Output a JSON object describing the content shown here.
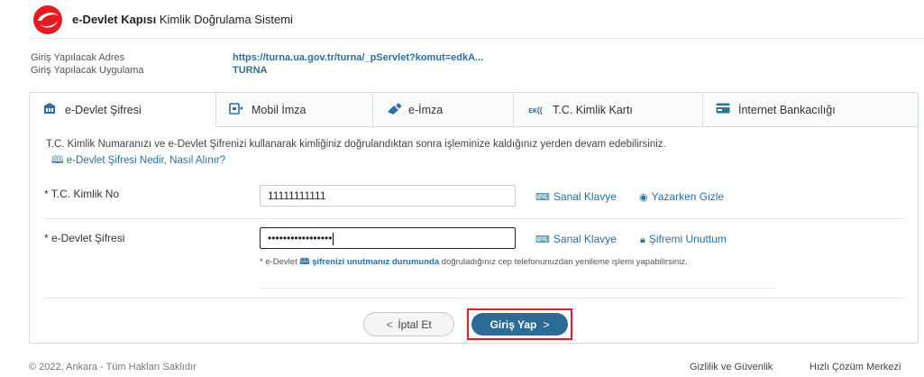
{
  "header": {
    "brand_bold": "e-Devlet Kapısı",
    "brand_rest": " Kimlik Doğrulama Sistemi",
    "logo_color": "#e31b23"
  },
  "meta": {
    "address_label": "Giriş Yapılacak Adres",
    "address_value": "https://turna.ua.gov.tr/turna/_pServlet?komut=edkA...",
    "app_label": "Giriş Yapılacak Uygulama",
    "app_value": "TURNA"
  },
  "tabs": [
    {
      "label": "e-Devlet Şifresi",
      "icon": "building-icon",
      "active": true
    },
    {
      "label": "Mobil İmza",
      "icon": "mobile-signature-icon",
      "active": false
    },
    {
      "label": "e-İmza",
      "icon": "usb-token-icon",
      "active": false
    },
    {
      "label": "T.C. Kimlik Kartı",
      "icon": "id-card-icon",
      "active": false
    },
    {
      "label": "İnternet Bankacılığı",
      "icon": "credit-card-icon",
      "active": false
    }
  ],
  "intro": {
    "text": "T.C. Kimlik Numaranızı ve e-Devlet Şifrenizi kullanarak kimliğiniz doğrulandıktan sonra işleminize kaldığınız yerden devam edebilirsiniz.",
    "help_link": "e-Devlet Şifresi Nedir, Nasıl Alınır?"
  },
  "form": {
    "tc_label": "* T.C. Kimlik No",
    "tc_value": "11111111111",
    "password_label": "* e-Devlet Şifresi",
    "password_value": "•••••••••••••••••",
    "virtual_keyboard": "Sanal Klavye",
    "hide_while_typing": "Yazarken Gizle",
    "forgot_password": "Şifremi Unuttum",
    "note_prefix": "* e-Devlet",
    "note_link": "şifrenizi unutmanız durumunda",
    "note_suffix": " doğruladığınız cep telefonunuzdan yenileme işlemi yapabilirsiniz."
  },
  "buttons": {
    "cancel": "İptal Et",
    "login": "Giriş Yap"
  },
  "footer": {
    "copyright": "© 2022, Ankara - Tüm Hakları Saklıdır",
    "privacy": "Gizlilik ve Güvenlik",
    "quick_help": "Hızlı Çözüm Merkezi"
  },
  "colors": {
    "accent": "#2a6fa0",
    "primary_button": "#2c6b96",
    "highlight_border": "#e31b23"
  }
}
